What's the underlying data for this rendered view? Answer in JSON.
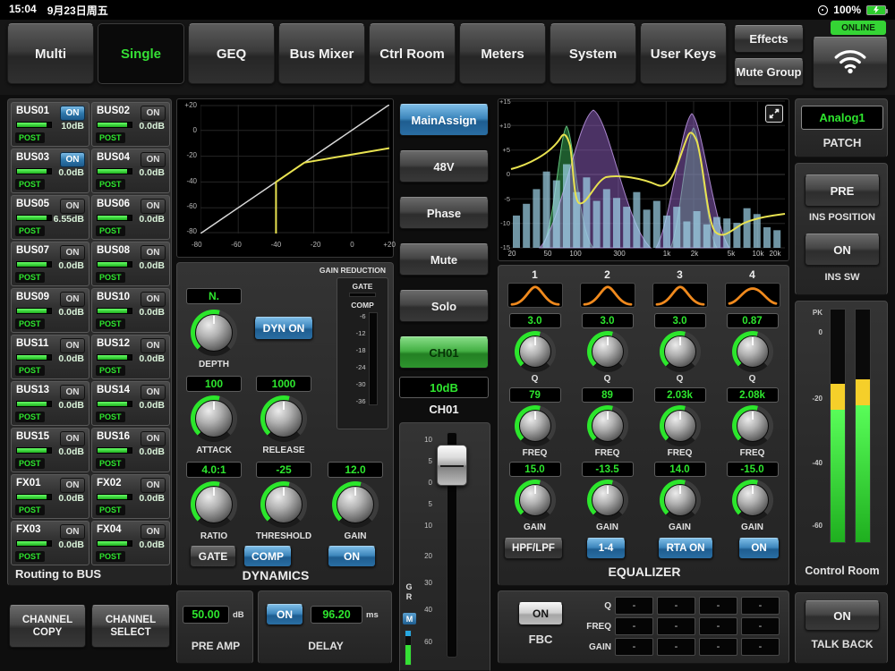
{
  "colors": {
    "accent_green": "#2ee62e",
    "active_blue": "#3d86bc",
    "value_green": "#2ee62e",
    "curve_yellow": "#e8e250",
    "rta_blue": "#9fd4ea",
    "band_purple": "#9a66c8",
    "band_green": "#3cb45a",
    "bell_orange": "#f08a1e",
    "online_green": "#35d435"
  },
  "statusbar": {
    "time": "15:04",
    "date": "9月23日周五",
    "battery": "100%",
    "online": "ONLINE"
  },
  "nav": {
    "tabs": [
      {
        "label": "Multi"
      },
      {
        "label": "Single",
        "active": true
      },
      {
        "label": "GEQ"
      },
      {
        "label": "Bus Mixer"
      },
      {
        "label": "Ctrl Room"
      },
      {
        "label": "Meters"
      },
      {
        "label": "System"
      },
      {
        "label": "User Keys"
      }
    ],
    "effects": "Effects",
    "mute_group": "Mute Group"
  },
  "routing": {
    "title": "Routing to BUS",
    "buses": [
      {
        "name": "BUS01",
        "on": "ON",
        "active": true,
        "value": "10dB",
        "tap": "POST"
      },
      {
        "name": "BUS02",
        "on": "ON",
        "active": false,
        "value": "0.0dB",
        "tap": "POST"
      },
      {
        "name": "BUS03",
        "on": "ON",
        "active": true,
        "value": "0.0dB",
        "tap": "POST"
      },
      {
        "name": "BUS04",
        "on": "ON",
        "active": false,
        "value": "0.0dB",
        "tap": "POST"
      },
      {
        "name": "BUS05",
        "on": "ON",
        "active": false,
        "value": "6.55dB",
        "tap": "POST"
      },
      {
        "name": "BUS06",
        "on": "ON",
        "active": false,
        "value": "0.0dB",
        "tap": "POST"
      },
      {
        "name": "BUS07",
        "on": "ON",
        "active": false,
        "value": "0.0dB",
        "tap": "POST"
      },
      {
        "name": "BUS08",
        "on": "ON",
        "active": false,
        "value": "0.0dB",
        "tap": "POST"
      },
      {
        "name": "BUS09",
        "on": "ON",
        "active": false,
        "value": "0.0dB",
        "tap": "POST"
      },
      {
        "name": "BUS10",
        "on": "ON",
        "active": false,
        "value": "0.0dB",
        "tap": "POST"
      },
      {
        "name": "BUS11",
        "on": "ON",
        "active": false,
        "value": "0.0dB",
        "tap": "POST"
      },
      {
        "name": "BUS12",
        "on": "ON",
        "active": false,
        "value": "0.0dB",
        "tap": "POST"
      },
      {
        "name": "BUS13",
        "on": "ON",
        "active": false,
        "value": "0.0dB",
        "tap": "POST"
      },
      {
        "name": "BUS14",
        "on": "ON",
        "active": false,
        "value": "0.0dB",
        "tap": "POST"
      },
      {
        "name": "BUS15",
        "on": "ON",
        "active": false,
        "value": "0.0dB",
        "tap": "POST"
      },
      {
        "name": "BUS16",
        "on": "ON",
        "active": false,
        "value": "0.0dB",
        "tap": "POST"
      },
      {
        "name": "FX01",
        "on": "ON",
        "active": false,
        "value": "0.0dB",
        "tap": "POST"
      },
      {
        "name": "FX02",
        "on": "ON",
        "active": false,
        "value": "0.0dB",
        "tap": "POST"
      },
      {
        "name": "FX03",
        "on": "ON",
        "active": false,
        "value": "0.0dB",
        "tap": "POST"
      },
      {
        "name": "FX04",
        "on": "ON",
        "active": false,
        "value": "0.0dB",
        "tap": "POST"
      }
    ],
    "channel_copy_line1": "CHANNEL",
    "channel_copy_line2": "COPY",
    "channel_select_line1": "CHANNEL",
    "channel_select_line2": "SELECT"
  },
  "dyn_curve": {
    "x_ticks": [
      "-80",
      "-60",
      "-40",
      "-20",
      "0",
      "+20"
    ],
    "y_ticks": [
      "+20",
      "0",
      "-20",
      "-40",
      "-60",
      "-80"
    ]
  },
  "dynamics": {
    "title": "DYNAMICS",
    "gain_reduction_label": "GAIN REDUCTION",
    "gate_meter_label": "GATE",
    "comp_meter_label": "COMP",
    "meter_ticks": [
      "-6",
      "-12",
      "-18",
      "-24",
      "-30",
      "-36"
    ],
    "dyn_on": "DYN ON",
    "depth": {
      "value": "N.",
      "label": "DEPTH"
    },
    "attack": {
      "value": "100",
      "label": "ATTACK"
    },
    "release": {
      "value": "1000",
      "label": "RELEASE"
    },
    "ratio": {
      "value": "4.0:1",
      "label": "RATIO"
    },
    "threshold": {
      "value": "-25",
      "label": "THRESHOLD"
    },
    "gain": {
      "value": "12.0",
      "label": "GAIN"
    },
    "gate_button": "GATE",
    "comp_button": "COMP",
    "on_button": "ON"
  },
  "preamp": {
    "value": "50.00",
    "unit": "dB",
    "label": "PRE AMP"
  },
  "delay": {
    "on_button": "ON",
    "value": "96.20",
    "unit": "ms",
    "label": "DELAY"
  },
  "channel": {
    "main_assign": "MainAssign",
    "phantom": "48V",
    "phase": "Phase",
    "mute": "Mute",
    "solo": "Solo",
    "select_name": "CH01",
    "gain": "10dB",
    "name": "CH01",
    "gr_label": "GR",
    "mono_badge": "M",
    "fader_ticks": [
      "10",
      "5",
      "0",
      "5",
      "10",
      "20",
      "30",
      "40",
      "60"
    ]
  },
  "eq": {
    "title": "EQUALIZER",
    "db_ticks": [
      "+15",
      "+10",
      "+5",
      "0",
      "-5",
      "-10",
      "-15"
    ],
    "freq_ticks": [
      "20",
      "50",
      "100",
      "300",
      "1k",
      "2k",
      "5k",
      "10k",
      "20k"
    ],
    "bands": [
      {
        "number": "1",
        "q": "3.0",
        "freq": "79",
        "gain": "15.0"
      },
      {
        "number": "2",
        "q": "3.0",
        "freq": "89",
        "gain": "-13.5"
      },
      {
        "number": "3",
        "q": "3.0",
        "freq": "2.03k",
        "gain": "14.0"
      },
      {
        "number": "4",
        "q": "0.87",
        "freq": "2.08k",
        "gain": "-15.0"
      }
    ],
    "q_label": "Q",
    "freq_label": "FREQ",
    "gain_label": "GAIN",
    "hpf_lpf_button": "HPF/LPF",
    "range_button": "1-4",
    "rta_button": "RTA ON",
    "on_button": "ON",
    "rta_bars": [
      22,
      30,
      40,
      52,
      46,
      57,
      38,
      48,
      32,
      40,
      34,
      28,
      38,
      26,
      32,
      22,
      28,
      18,
      25,
      16,
      21,
      20,
      17,
      27,
      23,
      14,
      12
    ]
  },
  "fbc": {
    "on_button": "ON",
    "label": "FBC",
    "row_labels": [
      "Q",
      "FREQ",
      "GAIN"
    ],
    "values": [
      [
        "-",
        "-",
        "-",
        "-"
      ],
      [
        "-",
        "-",
        "-",
        "-"
      ],
      [
        "-",
        "-",
        "-",
        "-"
      ]
    ]
  },
  "patch": {
    "value": "Analog1",
    "label": "PATCH"
  },
  "ins": {
    "position_button": "PRE",
    "position_label": "INS POSITION",
    "sw_button": "ON",
    "sw_label": "INS SW"
  },
  "control_room": {
    "label": "Control Room",
    "ticks": [
      "PK",
      "0",
      "-20",
      "-40",
      "-60"
    ]
  },
  "talkback": {
    "on_button": "ON",
    "label": "TALK BACK"
  }
}
